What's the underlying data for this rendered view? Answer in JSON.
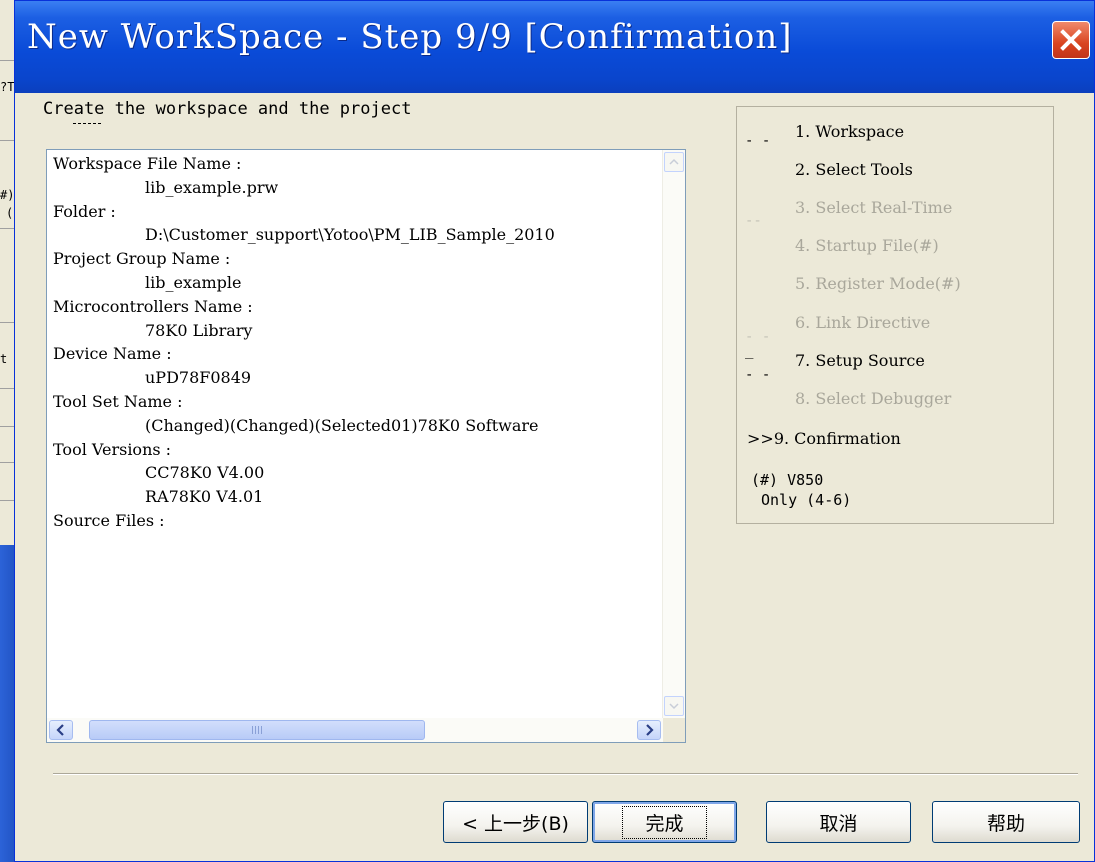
{
  "background": {
    "fragments": [
      "?T",
      "#)",
      "(",
      "t"
    ]
  },
  "window": {
    "title": "New WorkSpace - Step 9/9 [Confirmation]"
  },
  "heading": "Create the workspace and the project",
  "summary": {
    "lines": [
      {
        "text": "Workspace File Name :",
        "indent": false
      },
      {
        "text": "lib_example.prw",
        "indent": true
      },
      {
        "text": "Folder :",
        "indent": false
      },
      {
        "text": "D:\\Customer_support\\Yotoo\\PM_LIB_Sample_2010",
        "indent": true
      },
      {
        "text": "Project Group Name :",
        "indent": false
      },
      {
        "text": "lib_example",
        "indent": true
      },
      {
        "text": "Microcontrollers Name :",
        "indent": false
      },
      {
        "text": "78K0 Library",
        "indent": true
      },
      {
        "text": "Device Name :",
        "indent": false
      },
      {
        "text": "uPD78F0849",
        "indent": true
      },
      {
        "text": "Tool Set Name :",
        "indent": false
      },
      {
        "text": "(Changed)(Changed)(Selected01)78K0 Software",
        "indent": true
      },
      {
        "text": "Tool Versions :",
        "indent": false
      },
      {
        "text": "CC78K0 V4.00",
        "indent": true
      },
      {
        "text": "RA78K0 V4.01",
        "indent": true
      },
      {
        "text": "Source Files :",
        "indent": false
      }
    ]
  },
  "steps": {
    "items": [
      {
        "label": "1. Workspace",
        "enabled": true
      },
      {
        "label": "2. Select Tools",
        "enabled": true
      },
      {
        "label": "3. Select Real-Time",
        "enabled": false
      },
      {
        "label": "4. Startup File(#)",
        "enabled": false
      },
      {
        "label": "5. Register Mode(#)",
        "enabled": false
      },
      {
        "label": "6. Link Directive",
        "enabled": false
      },
      {
        "label": "7. Setup Source",
        "enabled": true
      },
      {
        "label": "8. Select Debugger",
        "enabled": false
      },
      {
        "label": ">>9. Confirmation",
        "enabled": true
      }
    ],
    "note_line1": "(#) V850",
    "note_line2": "Only (4-6)"
  },
  "buttons": {
    "back": "< 上一步(B)",
    "finish": "完成",
    "cancel": "取消",
    "help": "帮助"
  },
  "colors": {
    "title_bar": "#0a4bd8",
    "dialog_face": "#ece9d8",
    "close_button": "#d9441f",
    "disabled_text": "#a9a79b",
    "desktop": "#2a5bd0"
  }
}
